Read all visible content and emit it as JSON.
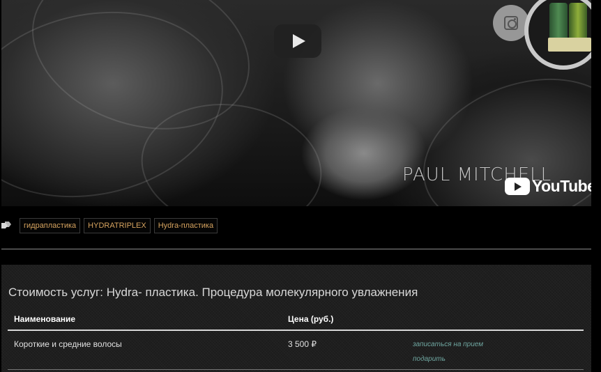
{
  "video": {
    "watermark": "PAUL MITCHELL",
    "youtube_label": "YouTube",
    "play_icon": "play-icon",
    "instagram_icon": "instagram-icon"
  },
  "tags": {
    "icon": "tags-icon",
    "items": [
      "гидрапластика",
      "HYDRATRIPLEX",
      "Hydra-пластика"
    ]
  },
  "prices": {
    "title": "Стоимость услуг: Hydra- пластика. Процедура молекулярного увлажнения",
    "headers": {
      "name": "Наименование",
      "price": "Цена (руб.)"
    },
    "rows": [
      {
        "name": "Короткие и средние волосы",
        "price": "3 500 ₽",
        "book_link": "записаться на прием",
        "gift_link": "подарить"
      }
    ]
  },
  "colors": {
    "tag_text": "#d6a35f",
    "link": "#6fa6a0",
    "background": "#000000"
  }
}
